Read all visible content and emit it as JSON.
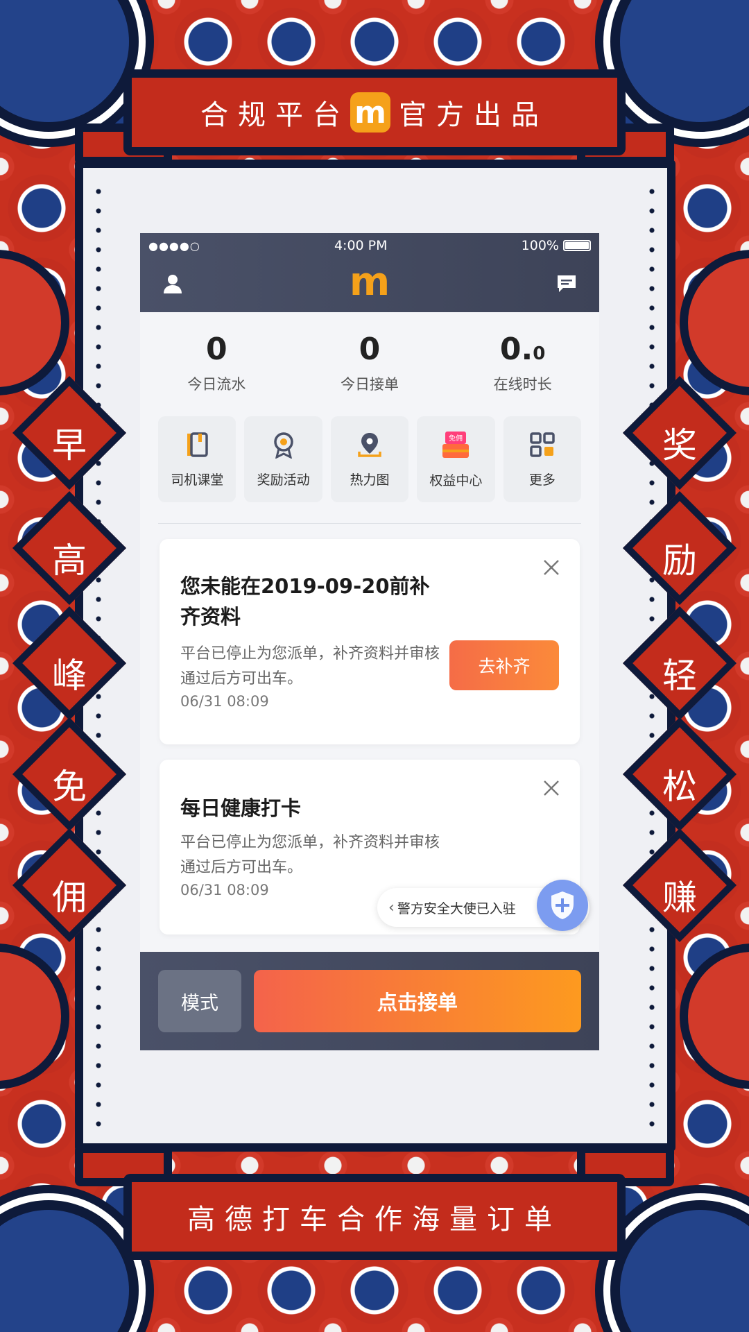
{
  "poster": {
    "top_banner_left": "合规平台",
    "top_banner_logo": "m",
    "top_banner_right": "官方出品",
    "bottom_banner": "高德打车合作海量订单",
    "left_chars": [
      "早",
      "高",
      "峰",
      "免",
      "佣"
    ],
    "right_chars": [
      "奖",
      "励",
      "轻",
      "松",
      "赚"
    ]
  },
  "status_bar": {
    "signal": "●●●●○",
    "time": "4:00 PM",
    "battery": "100%"
  },
  "nav": {
    "logo": "m",
    "left_icon": "user-icon",
    "right_icon": "message-icon"
  },
  "stats": [
    {
      "value": "0",
      "value_small": "",
      "label": "今日流水"
    },
    {
      "value": "0",
      "value_small": "",
      "label": "今日接单"
    },
    {
      "value": "0.",
      "value_small": "0",
      "label": "在线时长"
    }
  ],
  "shortcuts": [
    {
      "label": "司机课堂",
      "icon": "book-icon"
    },
    {
      "label": "奖励活动",
      "icon": "medal-icon"
    },
    {
      "label": "热力图",
      "icon": "location-pin-icon"
    },
    {
      "label": "权益中心",
      "icon": "gift-box-icon",
      "badge": "免佣"
    },
    {
      "label": "更多",
      "icon": "grid-icon"
    }
  ],
  "cards": [
    {
      "title": "您未能在2019-09-20前补齐资料",
      "body": "平台已停止为您派单，补齐资料并审核通过后方可出车。",
      "time": "06/31 08:09",
      "button": "去补齐"
    },
    {
      "title": "每日健康打卡",
      "body": "平台已停止为您派单，补齐资料并审核通过后方可出车。",
      "time": "06/31 08:09"
    }
  ],
  "police_pill": {
    "text": "警方安全大使已入驻"
  },
  "bottom": {
    "mode": "模式",
    "accept": "点击接单"
  },
  "colors": {
    "accent_orange": "#F5A11A",
    "button_gradient_start": "#F4634B",
    "button_gradient_end": "#FD9A1F",
    "banner_red": "#C32C1C",
    "frame_navy": "#0E1A3A",
    "topbar_slate": "#4A5168"
  }
}
